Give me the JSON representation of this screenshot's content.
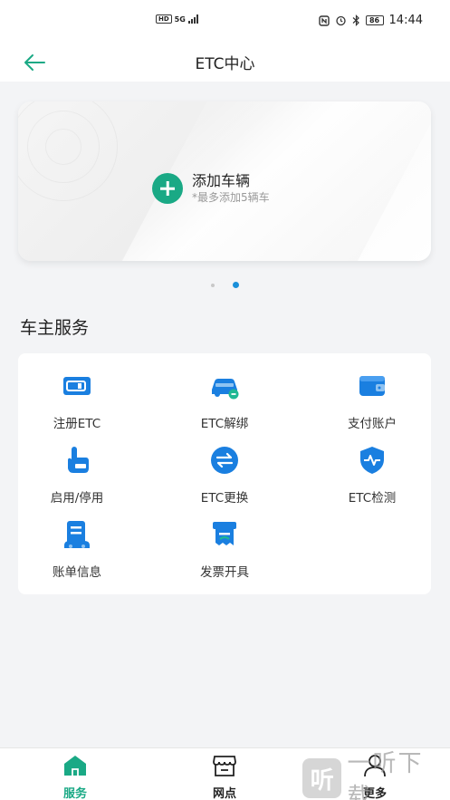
{
  "status_bar": {
    "left_badges": [
      "HD",
      "5G"
    ],
    "battery": "86",
    "time": "14:44"
  },
  "header": {
    "title": "ETC中心",
    "back_icon": "arrow-left-icon"
  },
  "car_card": {
    "add_title": "添加车辆",
    "add_subtitle": "*最多添加5辆车",
    "carousel_pages": 2,
    "carousel_active_index": 1
  },
  "services": {
    "title": "车主服务",
    "items": [
      {
        "label": "注册ETC",
        "icon": "etc-card-icon"
      },
      {
        "label": "ETC解绑",
        "icon": "car-unbind-icon"
      },
      {
        "label": "支付账户",
        "icon": "wallet-icon"
      },
      {
        "label": "启用/停用",
        "icon": "hand-tap-icon"
      },
      {
        "label": "ETC更换",
        "icon": "swap-icon"
      },
      {
        "label": "ETC检测",
        "icon": "shield-pulse-icon"
      },
      {
        "label": "账单信息",
        "icon": "bill-icon"
      },
      {
        "label": "发票开具",
        "icon": "invoice-icon"
      }
    ]
  },
  "bottom_nav": {
    "items": [
      {
        "label": "服务",
        "icon": "home-icon",
        "active": true
      },
      {
        "label": "网点",
        "icon": "store-icon",
        "active": false
      },
      {
        "label": "更多",
        "icon": "user-icon",
        "active": false
      }
    ]
  },
  "colors": {
    "accent": "#1aa985",
    "icon_blue": "#1a7fe0",
    "dot_active": "#1a8fd9"
  },
  "watermark": {
    "glyph": "听",
    "text": "一听下载"
  }
}
